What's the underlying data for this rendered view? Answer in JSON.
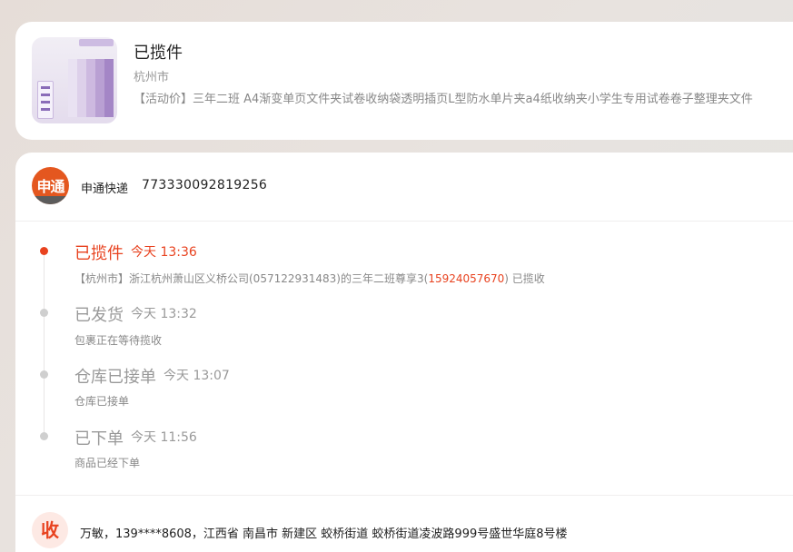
{
  "product": {
    "status": "已揽件",
    "city": "杭州市",
    "title": "【活动价】三年二班 A4渐变单页文件夹试卷收纳袋透明插页L型防水单片夹a4纸收纳夹小学生专用试卷卷子整理夹文件"
  },
  "shipment": {
    "carrier_logo_text": "申通",
    "carrier_name": "申通快递",
    "tracking_number": "773330092819256"
  },
  "events": [
    {
      "status": "已揽件",
      "time": "今天 13:36",
      "desc_prefix": "【杭州市】浙江杭州萧山区义桥公司(057122931483)的三年二班尊享3(",
      "desc_phone": "15924057670",
      "desc_suffix": ") 已揽收",
      "active": true
    },
    {
      "status": "已发货",
      "time": "今天 13:32",
      "desc": "包裹正在等待揽收",
      "active": false
    },
    {
      "status": "仓库已接单",
      "time": "今天 13:07",
      "desc": "仓库已接单",
      "active": false
    },
    {
      "status": "已下单",
      "time": "今天 11:56",
      "desc": "商品已经下单",
      "active": false
    }
  ],
  "receiver": {
    "badge": "收",
    "info": "万敏，139****8608，江西省 南昌市 新建区 蛟桥街道 蛟桥街道凌波路999号盛世华庭8号楼"
  },
  "colors": {
    "accent": "#e8421f",
    "carrier_orange": "#e4571f",
    "muted_text": "#999999"
  }
}
